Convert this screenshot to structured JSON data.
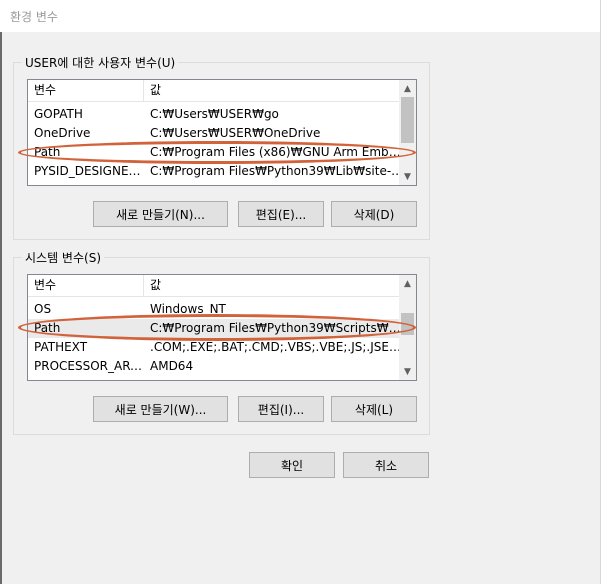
{
  "window": {
    "title": "환경 변수"
  },
  "user_vars": {
    "group_label": "USER에 대한 사용자 변수(U)",
    "columns": {
      "variable": "변수",
      "value": "값"
    },
    "rows": [
      {
        "name": "GOPATH",
        "value": "C:₩Users₩USER₩go"
      },
      {
        "name": "OneDrive",
        "value": "C:₩Users₩USER₩OneDrive"
      },
      {
        "name": "Path",
        "value": "C:₩Program Files (x86)₩GNU Arm Embedd..."
      },
      {
        "name": "PYSID_DESIGNER_...",
        "value": "C:₩Program Files₩Python39₩Lib₩site-pac..."
      }
    ],
    "buttons": {
      "new": "새로 만들기(N)...",
      "edit": "편집(E)...",
      "delete": "삭제(D)"
    }
  },
  "system_vars": {
    "group_label": "시스템 변수(S)",
    "columns": {
      "variable": "변수",
      "value": "값"
    },
    "rows": [
      {
        "name": "OS",
        "value": "Windows_NT"
      },
      {
        "name": "Path",
        "value": "C:₩Program Files₩Python39₩Scripts₩;C:₩..."
      },
      {
        "name": "PATHEXT",
        "value": ".COM;.EXE;.BAT;.CMD;.VBS;.VBE;.JS;.JSE;.W..."
      },
      {
        "name": "PROCESSOR_ARC...",
        "value": "AMD64"
      }
    ],
    "buttons": {
      "new": "새로 만들기(W)...",
      "edit": "편집(I)...",
      "delete": "삭제(L)"
    }
  },
  "footer": {
    "ok": "확인",
    "cancel": "취소"
  },
  "colors": {
    "highlight_oval": "#d2623a",
    "dialog_bg": "#f0f0f0",
    "button_bg": "#e1e1e1"
  }
}
